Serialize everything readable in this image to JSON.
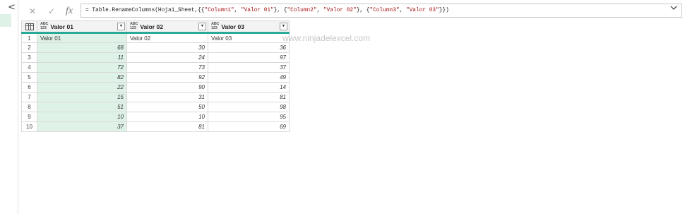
{
  "formula_bar": {
    "cancel_icon": "✕",
    "confirm_icon": "✓",
    "fx_label": "fx",
    "formula_prefix": "= Table.RenameColumns(Hoja1_Sheet,{{",
    "s1": "\"Column1\"",
    "sep1": ", ",
    "s2": "\"Valor 01\"",
    "sep2": "}, {",
    "s3": "\"Column2\"",
    "sep3": ", ",
    "s4": "\"Valor 02\"",
    "sep4": "}, {",
    "s5": "\"Column3\"",
    "sep5": ", ",
    "s6": "\"Valor 03\"",
    "formula_suffix": "}})",
    "expand_icon": "chevron-down-icon"
  },
  "left_pane": {
    "collapse_icon": "<"
  },
  "table": {
    "type_icon_top": "ABC",
    "type_icon_bottom": "123",
    "dropdown_glyph": "▾",
    "columns": [
      "Valor 01",
      "Valor 02",
      "Valor 03"
    ],
    "rows": [
      {
        "n": "1",
        "v1": "Valor 01",
        "v2": "Valor 02",
        "v3": "Valor 03"
      },
      {
        "n": "2",
        "v1": "68",
        "v2": "30",
        "v3": "36"
      },
      {
        "n": "3",
        "v1": "11",
        "v2": "24",
        "v3": "97"
      },
      {
        "n": "4",
        "v1": "72",
        "v2": "73",
        "v3": "37"
      },
      {
        "n": "5",
        "v1": "82",
        "v2": "92",
        "v3": "49"
      },
      {
        "n": "6",
        "v1": "22",
        "v2": "90",
        "v3": "14"
      },
      {
        "n": "7",
        "v1": "15",
        "v2": "31",
        "v3": "81"
      },
      {
        "n": "8",
        "v1": "51",
        "v2": "50",
        "v3": "98"
      },
      {
        "n": "9",
        "v1": "10",
        "v2": "10",
        "v3": "95"
      },
      {
        "n": "10",
        "v1": "37",
        "v2": "81",
        "v3": "69"
      }
    ]
  },
  "watermark": "www.ninjadelexcel.com",
  "colors": {
    "accent": "#2aa898",
    "selected_column": "#dff2e8"
  }
}
